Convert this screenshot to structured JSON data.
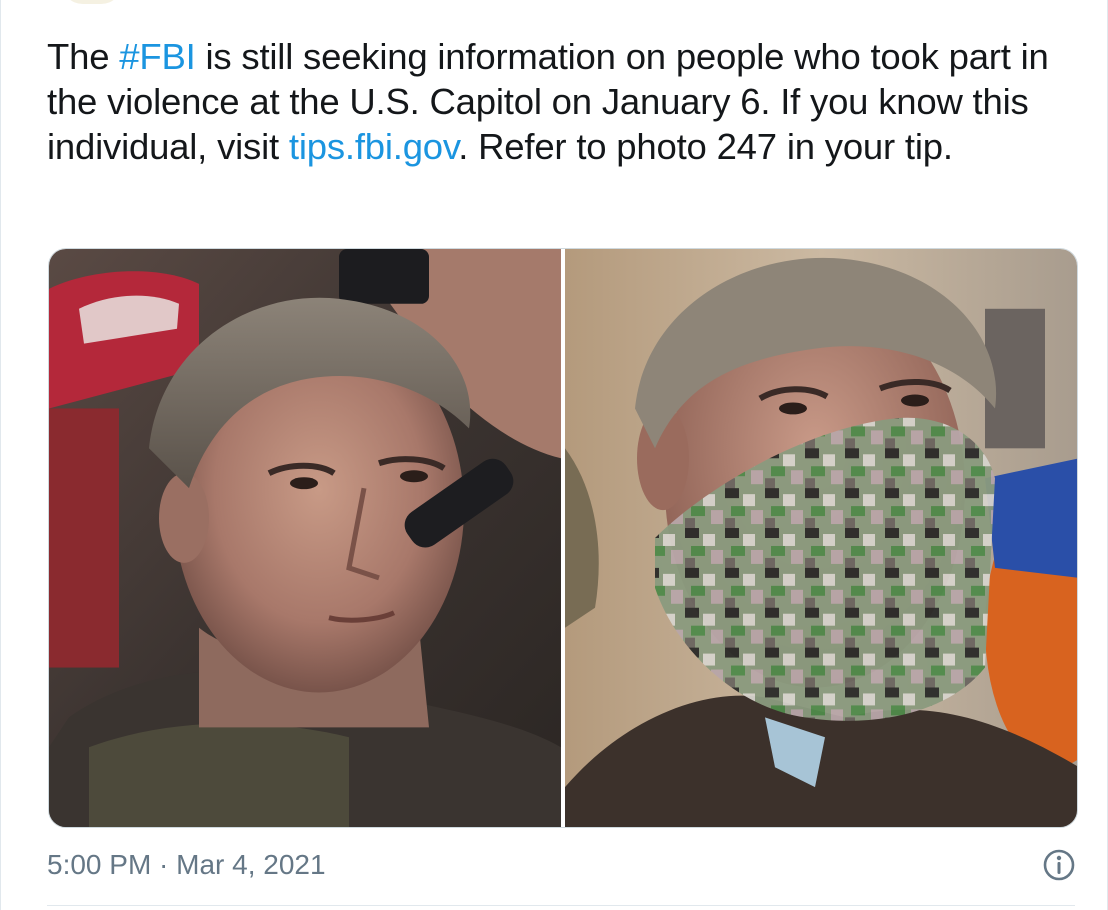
{
  "tweet": {
    "text_segments": [
      {
        "id": "t0",
        "text": "The ",
        "is_link": false
      },
      {
        "id": "t1",
        "text": "#FBI",
        "is_link": true
      },
      {
        "id": "t2",
        "text": " is still seeking information on people who took part in the violence at the U.S. Capitol on January 6. If you know this individual, visit ",
        "is_link": false
      },
      {
        "id": "t3",
        "text": "tips.fbi.gov",
        "is_link": true
      },
      {
        "id": "t4",
        "text": ". Refer to photo 247 in your tip.",
        "is_link": false
      }
    ],
    "hashtag": "#FBI",
    "link": "tips.fbi.gov",
    "timestamp": "5:00 PM · Mar 4, 2021"
  },
  "media": {
    "photos": [
      {
        "name": "photo-left",
        "description": "man-with-grey-hair-holding-phone"
      },
      {
        "name": "photo-right",
        "description": "man-with-camo-gaiter-mask"
      }
    ]
  },
  "icons": {
    "info": "info-icon"
  },
  "colors": {
    "text": "#14171a",
    "link": "#1b95e0",
    "muted": "#657786",
    "border": "#e1e8ed"
  }
}
